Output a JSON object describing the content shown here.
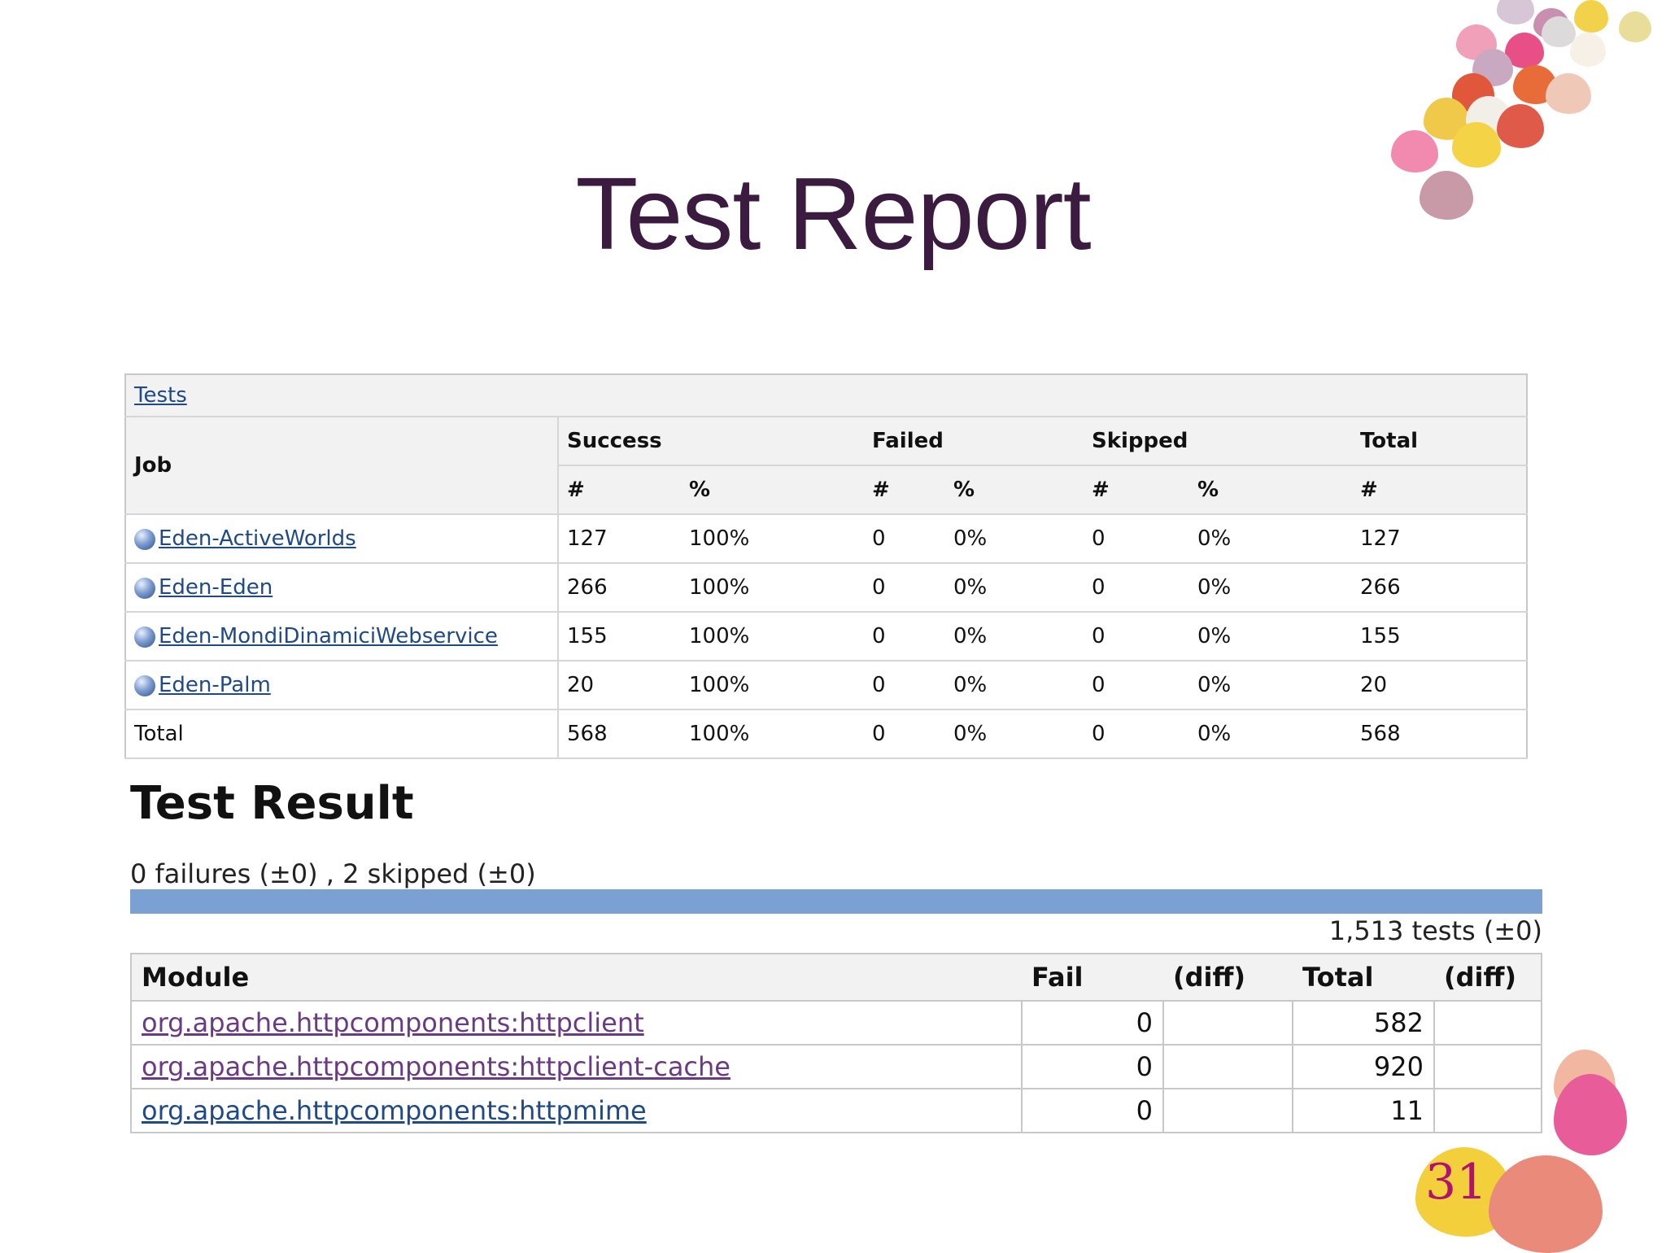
{
  "slide": {
    "title": "Test Report",
    "page_number": "31"
  },
  "tests_table": {
    "caption": "Tests",
    "headers": {
      "job": "Job",
      "success": "Success",
      "failed": "Failed",
      "skipped": "Skipped",
      "total": "Total",
      "count_symbol": "#",
      "percent_symbol": "%"
    },
    "rows": [
      {
        "job": "Eden-ActiveWorlds",
        "success_n": "127",
        "success_p": "100%",
        "failed_n": "0",
        "failed_p": "0%",
        "skipped_n": "0",
        "skipped_p": "0%",
        "total": "127"
      },
      {
        "job": "Eden-Eden",
        "success_n": "266",
        "success_p": "100%",
        "failed_n": "0",
        "failed_p": "0%",
        "skipped_n": "0",
        "skipped_p": "0%",
        "total": "266"
      },
      {
        "job": "Eden-MondiDinamiciWebservice",
        "success_n": "155",
        "success_p": "100%",
        "failed_n": "0",
        "failed_p": "0%",
        "skipped_n": "0",
        "skipped_p": "0%",
        "total": "155"
      },
      {
        "job": "Eden-Palm",
        "success_n": "20",
        "success_p": "100%",
        "failed_n": "0",
        "failed_p": "0%",
        "skipped_n": "0",
        "skipped_p": "0%",
        "total": "20"
      }
    ],
    "total_row": {
      "job": "Total",
      "success_n": "568",
      "success_p": "100%",
      "failed_n": "0",
      "failed_p": "0%",
      "skipped_n": "0",
      "skipped_p": "0%",
      "total": "568"
    }
  },
  "test_result": {
    "title": "Test Result",
    "summary": "0 failures (±0) , 2 skipped (±0)",
    "tests_count": "1,513 tests (±0)",
    "pass_fraction": 1.0,
    "columns": [
      "Module",
      "Fail",
      "(diff)",
      "Total",
      "(diff)"
    ],
    "modules": [
      {
        "name": "org.apache.httpcomponents:httpclient",
        "fail": "0",
        "fail_diff": "",
        "total": "582",
        "total_diff": ""
      },
      {
        "name": "org.apache.httpcomponents:httpclient-cache",
        "fail": "0",
        "fail_diff": "",
        "total": "920",
        "total_diff": ""
      },
      {
        "name": "org.apache.httpcomponents:httpmime",
        "fail": "0",
        "fail_diff": "",
        "total": "11",
        "total_diff": ""
      }
    ]
  },
  "colors": {
    "title": "#3b1c40",
    "progress_bar": "#7aa0d4",
    "page_number": "#b0126f"
  }
}
